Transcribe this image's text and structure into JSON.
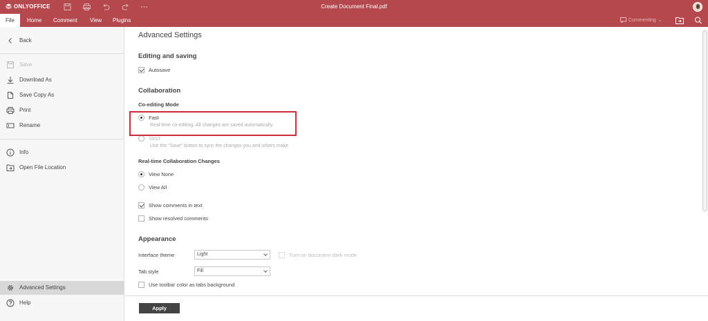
{
  "app": {
    "logo_text": "ONLYOFFICE",
    "doc_title": "Create Document Final.pdf"
  },
  "colors": {
    "brand": "#b5484d",
    "highlight": "#d3273a",
    "apply_bg": "#444444"
  },
  "titlebar_icons": [
    "save-icon",
    "print-icon",
    "undo-icon",
    "redo-icon",
    "more-icon"
  ],
  "tabs": [
    {
      "label": "File",
      "active": true
    },
    {
      "label": "Home"
    },
    {
      "label": "Comment"
    },
    {
      "label": "View"
    },
    {
      "label": "Plugins"
    }
  ],
  "mode": {
    "label": "Commenting"
  },
  "left_menu": {
    "back": "Back",
    "save": "Save",
    "download_as": "Download As",
    "save_copy_as": "Save Copy As",
    "print": "Print",
    "rename": "Rename",
    "info": "Info",
    "open_file_location": "Open File Location",
    "advanced_settings": "Advanced Settings",
    "help": "Help"
  },
  "settings": {
    "heading": "Advanced Settings",
    "editing": {
      "title": "Editing and saving",
      "autosave": "Autosave",
      "autosave_checked": true
    },
    "collaboration": {
      "title": "Collaboration",
      "coediting_mode_label": "Co-editing Mode",
      "fast": {
        "label": "Fast",
        "hint": "Real-time co-editing. All changes are saved automatically",
        "selected": true
      },
      "strict": {
        "label": "Strict",
        "hint": "Use the \"Save\" button to sync the changes you and others make",
        "selected": false
      },
      "realtime_label": "Real-time Collaboration Changes",
      "view_none": "View None",
      "view_all": "View All",
      "show_comments": "Show comments in text",
      "show_comments_checked": true,
      "show_resolved": "Show resolved comments",
      "show_resolved_checked": false
    },
    "appearance": {
      "title": "Appearance",
      "interface_theme_label": "Interface theme",
      "interface_theme_value": "Light",
      "dark_mode_label": "Turn on document dark mode",
      "tab_style_label": "Tab style",
      "tab_style_value": "Fill",
      "toolbar_color_label": "Use toolbar color as tabs background"
    },
    "apply": "Apply"
  }
}
